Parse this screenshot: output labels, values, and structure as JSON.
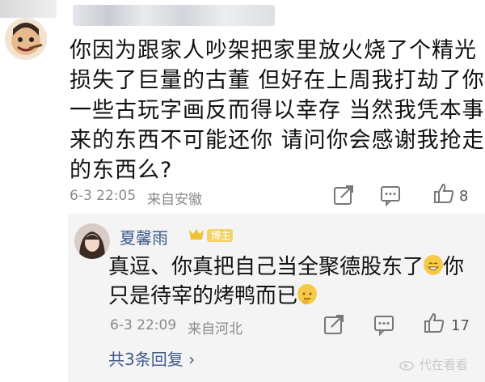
{
  "comment": {
    "lines": [
      "你因为跟家人吵架把家里放火烧了个精光 你",
      "损失了巨量的古董  但好在上周我打劫了你家",
      "一些古玩字画反而得以幸存  当然我凭本事抢",
      "来的东西不可能还你  请问你会感谢我抢走你",
      "的东西么?"
    ],
    "timestamp": "6-3 22:05",
    "location": "来自安徽",
    "like_count": "8",
    "icons": [
      "share-icon",
      "comment-icon",
      "like-icon"
    ]
  },
  "reply": {
    "username": "夏馨雨",
    "badge_label": "博主",
    "line1": "真逗、你真把自己当全聚德股东了",
    "line1_tail": "你",
    "line2": "只是待宰的烤鸭而已",
    "timestamp": "6-3 22:09",
    "location": "来自河北",
    "like_count": "17",
    "more_replies": "共3条回复 ›",
    "icons": [
      "share-icon",
      "comment-icon",
      "like-icon",
      "grin-emoji-icon",
      "thinking-emoji-icon"
    ]
  },
  "watermark": "代在看看",
  "colors": {
    "name": "#3d5a8a",
    "meta": "#8a8a8a",
    "reply_bg": "#f4f4f4",
    "badge": "#f0c23a"
  }
}
